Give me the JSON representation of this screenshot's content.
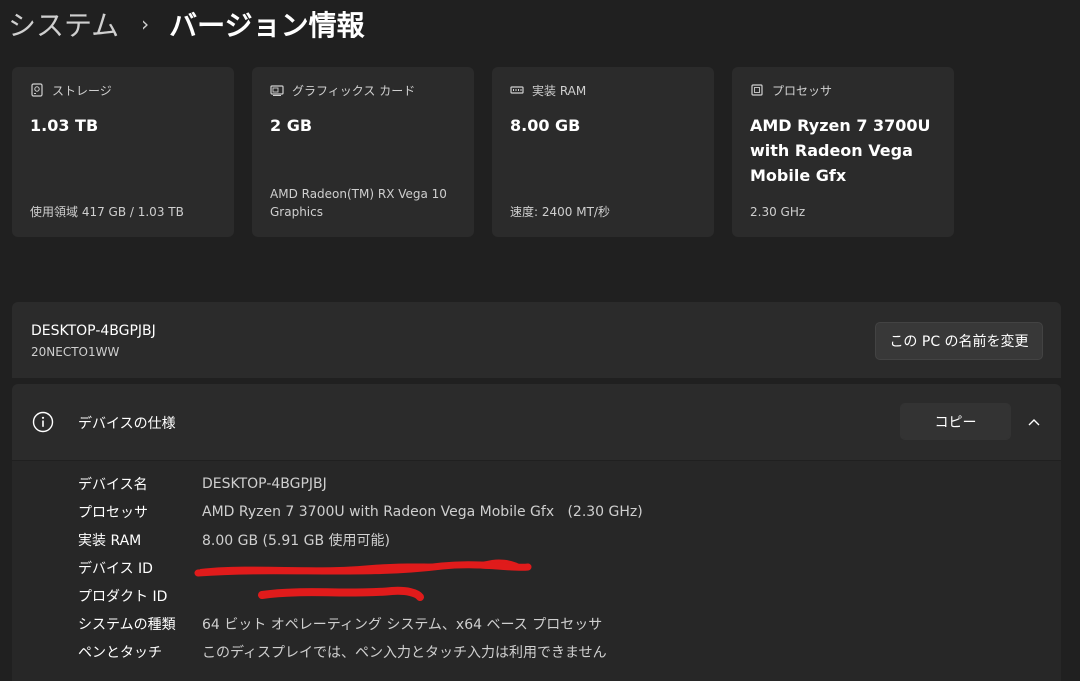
{
  "breadcrumb": {
    "parent": "システム",
    "separator": "›",
    "current": "バージョン情報"
  },
  "cards": [
    {
      "icon": "storage-icon",
      "title": "ストレージ",
      "value": "1.03 TB",
      "sub": "使用領域 417 GB / 1.03 TB"
    },
    {
      "icon": "graphics-card-icon",
      "title": "グラフィックス カード",
      "value": "2 GB",
      "sub_lines": [
        "AMD Radeon(TM) RX Vega 10",
        "Graphics"
      ]
    },
    {
      "icon": "memory-icon",
      "title": "実装 RAM",
      "value": "8.00 GB",
      "sub": "速度: 2400 MT/秒"
    },
    {
      "icon": "processor-icon",
      "title": "プロセッサ",
      "value_lines": [
        "AMD Ryzen 7 3700U",
        "with Radeon Vega",
        "Mobile Gfx"
      ],
      "sub": "2.30 GHz"
    }
  ],
  "pc": {
    "name": "DESKTOP-4BGPJBJ",
    "model": "20NECTO1WW",
    "rename_label": "この PC の名前を変更"
  },
  "device_specs": {
    "title": "デバイスの仕様",
    "copy_label": "コピー",
    "rows": [
      {
        "label": "デバイス名",
        "value": "DESKTOP-4BGPJBJ"
      },
      {
        "label": "プロセッサ",
        "value": "AMD Ryzen 7 3700U with Radeon Vega Mobile Gfx   (2.30 GHz)"
      },
      {
        "label": "実装 RAM",
        "value": "8.00 GB (5.91 GB 使用可能)"
      },
      {
        "label": "デバイス ID",
        "value": ""
      },
      {
        "label": "プロダクト ID",
        "value": ""
      },
      {
        "label": "システムの種類",
        "value": "64 ビット オペレーティング システム、x64 ベース プロセッサ"
      },
      {
        "label": "ペンとタッチ",
        "value": "このディスプレイでは、ペン入力とタッチ入力は利用できません"
      }
    ]
  },
  "colors": {
    "background": "#202020",
    "card": "#2b2b2b",
    "redaction": "#e01b1b"
  }
}
